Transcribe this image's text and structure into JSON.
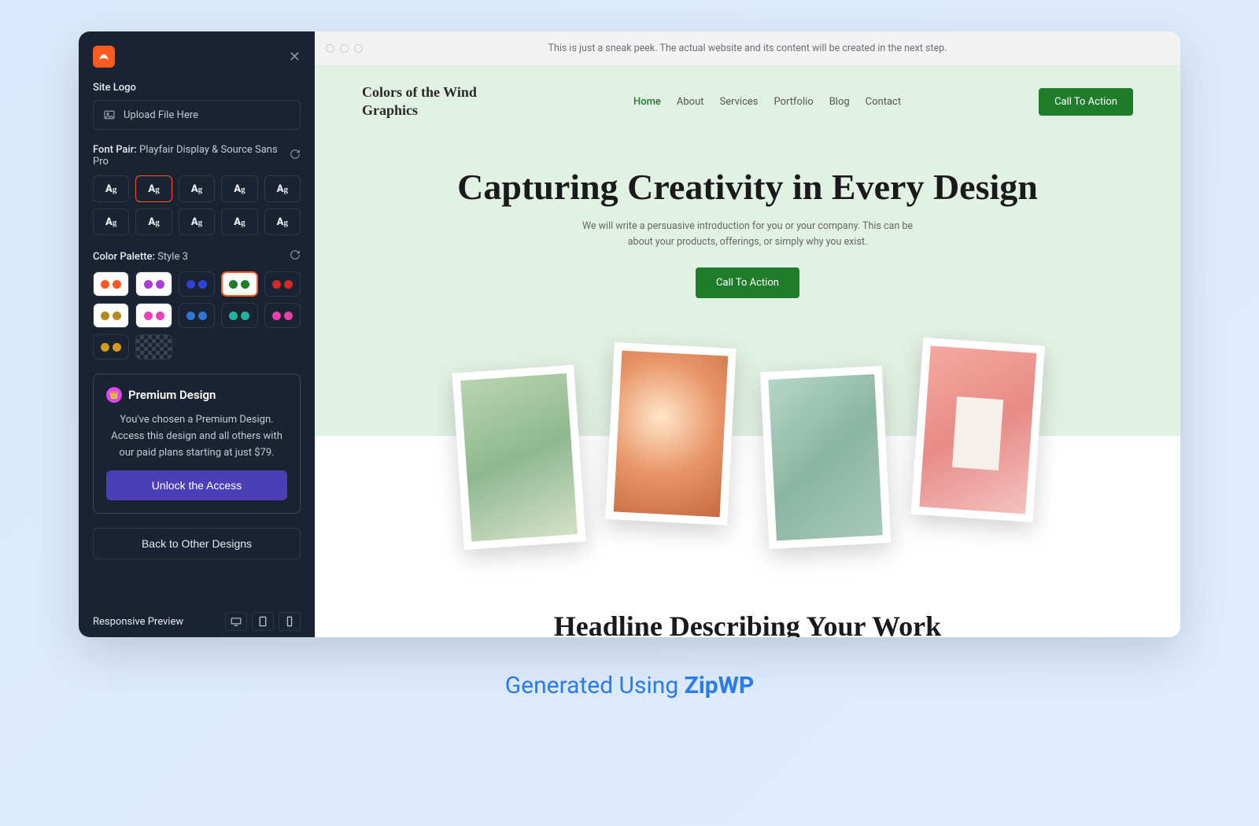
{
  "sidebar": {
    "site_logo_label": "Site Logo",
    "upload_placeholder": "Upload File Here",
    "font_pair_label": "Font Pair:",
    "font_pair_value": "Playfair Display & Source Sans Pro",
    "font_tile_glyph": "Ag",
    "font_selected_index": 1,
    "color_palette_label": "Color Palette:",
    "color_palette_value": "Style 3",
    "color_selected_index": 3,
    "palettes": [
      {
        "bg": "light",
        "c1": "#ff5a1f",
        "c2": "#ff5a1f"
      },
      {
        "bg": "light",
        "c1": "#a63dd4",
        "c2": "#a63dd4"
      },
      {
        "bg": "dark",
        "c1": "#2a44d6",
        "c2": "#2a44d6"
      },
      {
        "bg": "light",
        "c1": "#1f7c2a",
        "c2": "#1f7c2a"
      },
      {
        "bg": "dark",
        "c1": "#d62a2a",
        "c2": "#d62a2a"
      },
      {
        "bg": "light",
        "c1": "#b38a1f",
        "c2": "#b38a1f"
      },
      {
        "bg": "light",
        "c1": "#e843b6",
        "c2": "#e843b6"
      },
      {
        "bg": "dark",
        "c1": "#2a77d6",
        "c2": "#2a77d6"
      },
      {
        "bg": "dark",
        "c1": "#1fb5a0",
        "c2": "#1fb5a0"
      },
      {
        "bg": "dark",
        "c1": "#e83fa8",
        "c2": "#e83fa8"
      },
      {
        "bg": "dark",
        "c1": "#d49a1f",
        "c2": "#d49a1f"
      },
      {
        "bg": "trans",
        "c1": "",
        "c2": ""
      }
    ],
    "premium_title": "Premium Design",
    "premium_desc": "You've chosen a Premium Design. Access this design and all others with our paid plans starting at just $79.",
    "unlock_label": "Unlock the Access",
    "back_label": "Back to Other Designs",
    "responsive_label": "Responsive Preview"
  },
  "preview": {
    "peek_text": "This is just a sneak peek. The actual website and its content will be created in the next step.",
    "site_title": "Colors of the Wind Graphics",
    "nav": [
      "Home",
      "About",
      "Services",
      "Portfolio",
      "Blog",
      "Contact"
    ],
    "cta_label": "Call To Action",
    "hero_headline": "Capturing Creativity in Every Design",
    "hero_sub": "We will write a persuasive introduction for you or your company. This can be about your products, offerings, or simply why you exist.",
    "section2_headline": "Headline Describing Your Work Process Will Be Here"
  },
  "caption_prefix": "Generated Using ",
  "caption_brand": "ZipWP"
}
